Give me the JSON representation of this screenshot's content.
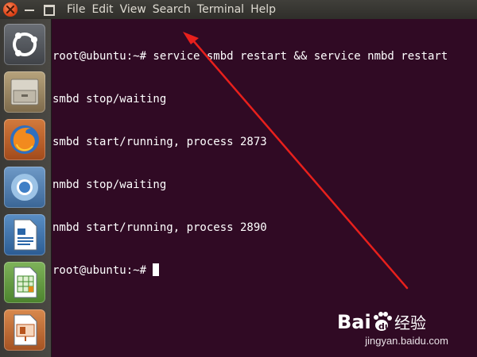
{
  "window": {
    "menu": [
      "File",
      "Edit",
      "View",
      "Search",
      "Terminal",
      "Help"
    ]
  },
  "launcher": {
    "items": [
      {
        "name": "ubuntu-dash-icon"
      },
      {
        "name": "file-manager-icon"
      },
      {
        "name": "firefox-icon"
      },
      {
        "name": "chromium-icon"
      },
      {
        "name": "libreoffice-writer-icon"
      },
      {
        "name": "libreoffice-calc-icon"
      },
      {
        "name": "libreoffice-impress-icon"
      }
    ]
  },
  "terminal": {
    "lines": [
      "root@ubuntu:~# service smbd restart && service nmbd restart",
      "smbd stop/waiting",
      "smbd start/running, process 2873",
      "nmbd stop/waiting",
      "nmbd start/running, process 2890",
      "root@ubuntu:~# "
    ]
  },
  "annotation": {
    "arrow_color": "#e8201c"
  },
  "watermark": {
    "logo_text": "Bai du 经验",
    "url": "jingyan.baidu.com"
  },
  "colors": {
    "terminal_bg": "#300a24",
    "text": "#ffffff",
    "accent": "#e0451a"
  }
}
